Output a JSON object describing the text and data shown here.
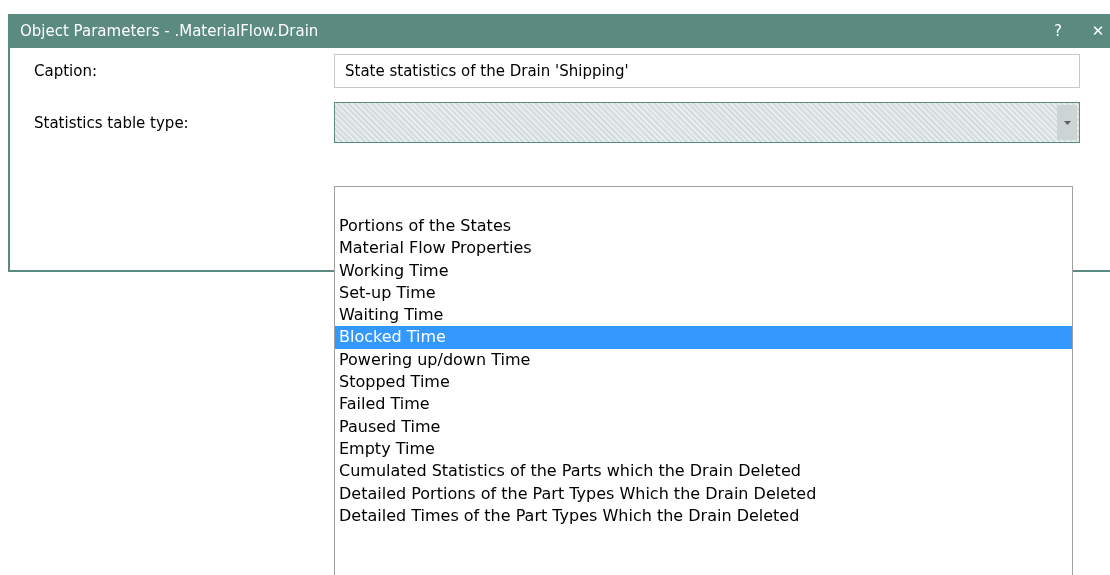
{
  "window": {
    "title": "Object Parameters - .MaterialFlow.Drain",
    "help_button": "?",
    "close_button": "✕"
  },
  "fields": [
    {
      "label": "Caption:",
      "kind": "text",
      "value": "State statistics of the Drain 'Shipping'"
    },
    {
      "label": "Statistics table type:",
      "kind": "combo"
    }
  ],
  "dropdown": {
    "items": [
      {
        "label": "Portions of the States",
        "selected": false
      },
      {
        "label": "Material Flow Properties",
        "selected": false
      },
      {
        "label": "Working Time",
        "selected": false
      },
      {
        "label": "Set-up Time",
        "selected": false
      },
      {
        "label": "Waiting Time",
        "selected": false
      },
      {
        "label": "Blocked Time",
        "selected": true
      },
      {
        "label": "Powering up/down Time",
        "selected": false
      },
      {
        "label": "Stopped Time",
        "selected": false
      },
      {
        "label": "Failed Time",
        "selected": false
      },
      {
        "label": "Paused Time",
        "selected": false
      },
      {
        "label": "Empty Time",
        "selected": false
      },
      {
        "label": "Cumulated Statistics of the Parts which the Drain Deleted",
        "selected": false
      },
      {
        "label": "Detailed Portions of the Part Types Which the Drain Deleted",
        "selected": false
      },
      {
        "label": "Detailed Times of the Part Types Which the Drain Deleted",
        "selected": false
      }
    ]
  }
}
